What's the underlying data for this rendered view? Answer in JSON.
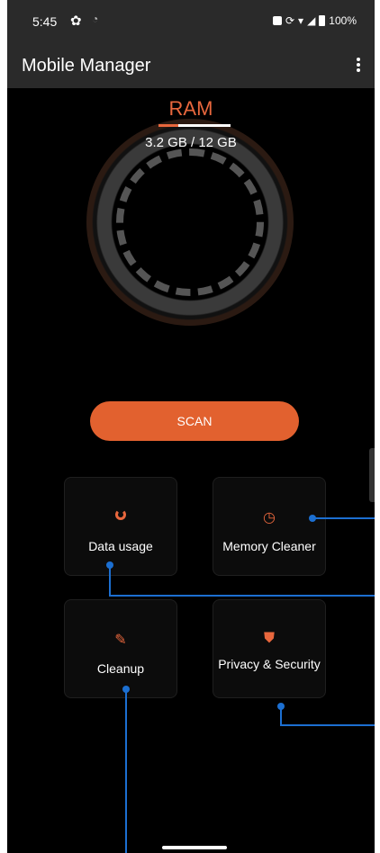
{
  "status_bar": {
    "time": "5:45",
    "battery": "100%",
    "icons": [
      "gear-icon",
      "wifi-icon",
      "screen-icon",
      "sync-icon",
      "wifi-signal-icon",
      "cell-signal-icon",
      "battery-icon"
    ]
  },
  "app_bar": {
    "title": "Mobile Manager",
    "menu_icon": "more-vert-icon"
  },
  "ram": {
    "label": "RAM",
    "value": "3.2 GB / 12 GB",
    "used_fraction": 0.27
  },
  "scan": {
    "label": "SCAN"
  },
  "tiles": [
    {
      "label": "Data usage",
      "icon": "data-usage-icon"
    },
    {
      "label": "Memory Cleaner",
      "icon": "speedometer-icon"
    },
    {
      "label": "Cleanup",
      "icon": "broom-icon"
    },
    {
      "label": "Privacy & Security",
      "icon": "shield-icon"
    }
  ],
  "colors": {
    "accent": "#e2612f",
    "annotation": "#1c6fd1",
    "bar_background": "#2a2a2a"
  }
}
